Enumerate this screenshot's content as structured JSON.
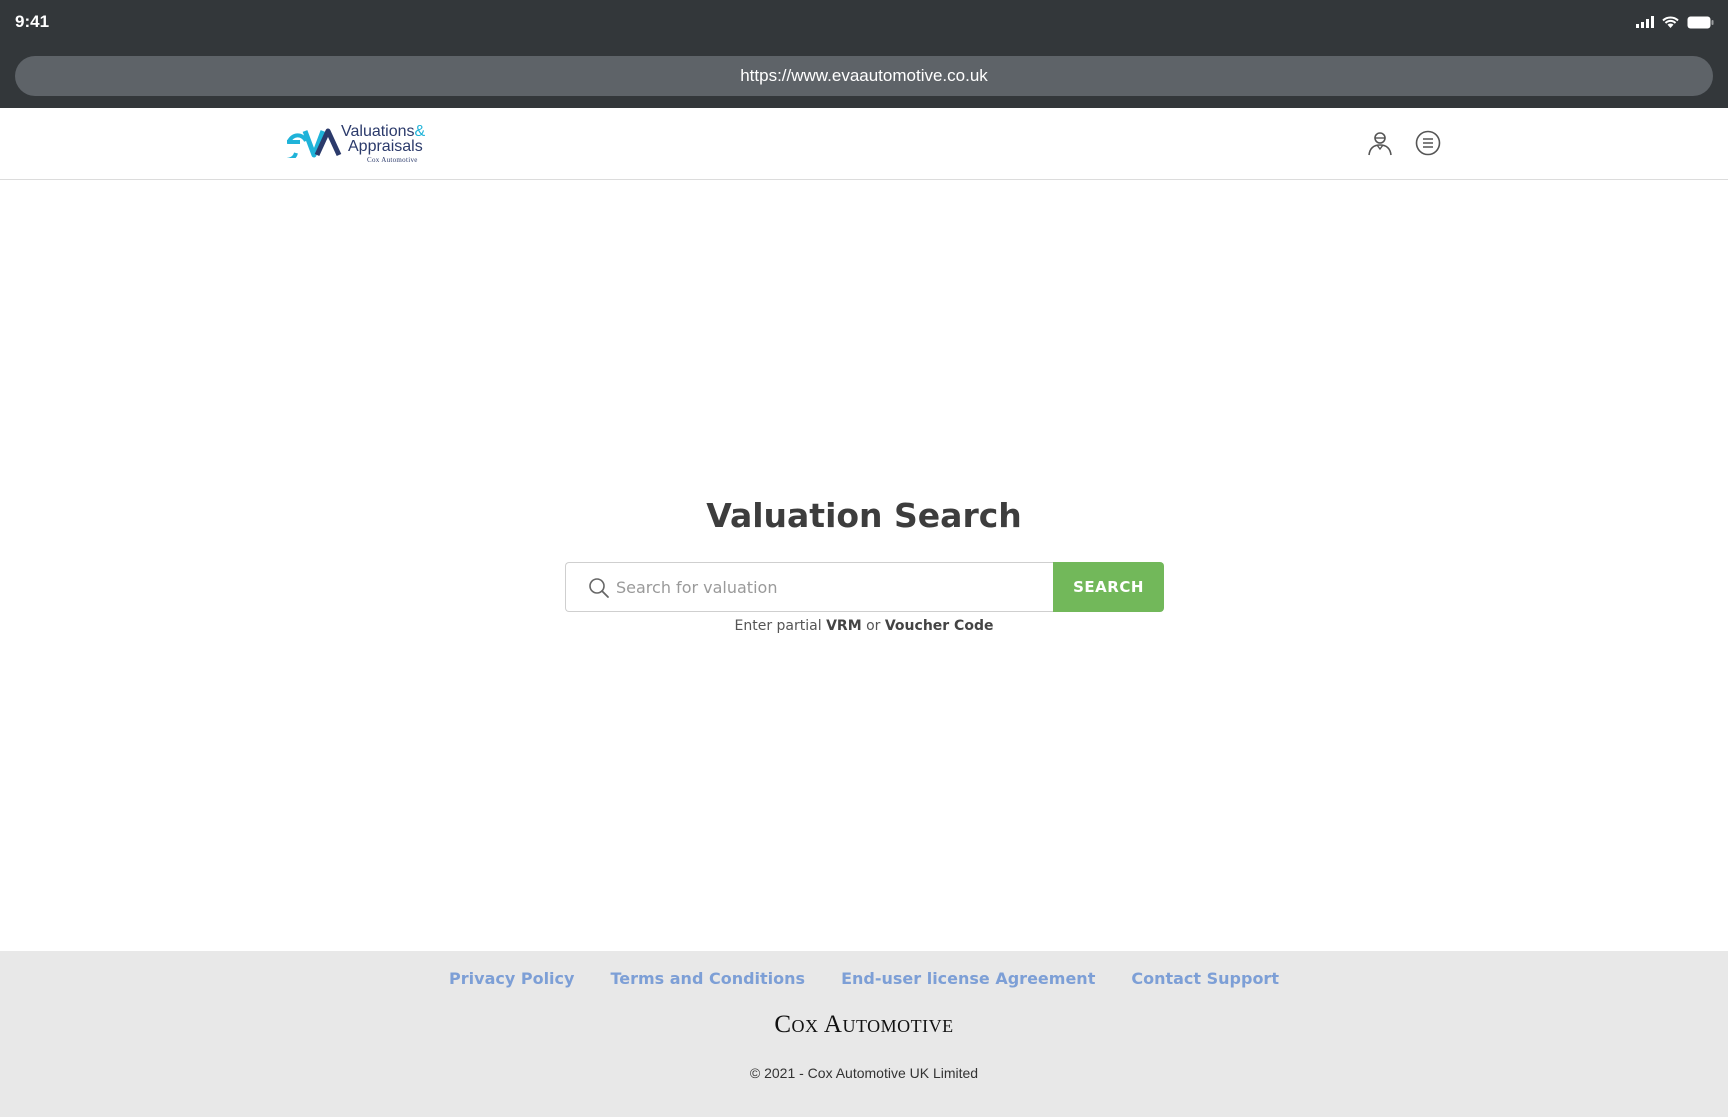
{
  "status_bar": {
    "time": "9:41",
    "icons": [
      "signal-icon",
      "wifi-icon",
      "battery-icon"
    ]
  },
  "browser": {
    "url": "https://www.evaautomotive.co.uk"
  },
  "header": {
    "logo": {
      "mark": "eVA",
      "line1": "Valuations",
      "amp": "&",
      "line2": "Appraisals",
      "line3": "Cox Automotive"
    },
    "icons": [
      "user-icon",
      "menu-icon"
    ]
  },
  "main": {
    "title": "Valuation Search",
    "search": {
      "placeholder": "Search for valuation",
      "value": "",
      "button_label": "SEARCH"
    },
    "hint": {
      "prefix": "Enter partial",
      "vrm": "VRM",
      "or": "or",
      "voucher": "Voucher Code"
    }
  },
  "footer": {
    "links": [
      "Privacy Policy",
      "Terms and Conditions",
      "End-user license Agreement",
      "Contact Support"
    ],
    "brand": "Cox Automotive",
    "copyright": "© 2021 - Cox Automotive UK Limited"
  },
  "colors": {
    "chrome": "#33373a",
    "url_bar": "#5e6368",
    "accent_green": "#72b85a",
    "link_blue": "#7d9fd6",
    "logo_cyan": "#1fb3d9",
    "logo_navy": "#2b3a6b",
    "footer_bg": "#e8e8e8"
  }
}
